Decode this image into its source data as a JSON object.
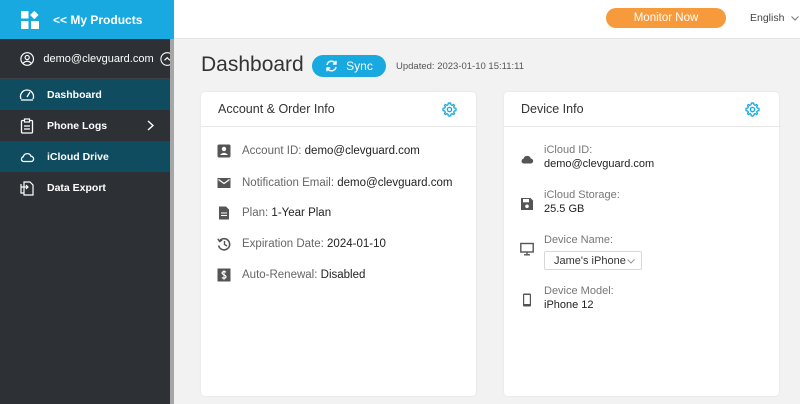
{
  "brand": {
    "title": "<< My Products"
  },
  "topbar": {
    "monitor_label": "Monitor Now",
    "language": "English"
  },
  "sidebar": {
    "user_email": "demo@clevguard.com",
    "items": [
      {
        "label": "Dashboard",
        "icon": "dashboard-gauge-icon",
        "active": true
      },
      {
        "label": "Phone Logs",
        "icon": "clipboard-icon",
        "active": false
      },
      {
        "label": "iCloud Drive",
        "icon": "cloud-icon",
        "active": true
      },
      {
        "label": "Data Export",
        "icon": "export-icon",
        "active": false
      }
    ]
  },
  "main": {
    "title": "Dashboard",
    "sync_label": "Sync",
    "updated": "Updated: 2023-01-10 15:11:11"
  },
  "account_card": {
    "title": "Account & Order Info",
    "rows": [
      {
        "label": "Account ID:",
        "value": "demo@clevguard.com",
        "icon": "id-card-icon"
      },
      {
        "label": "Notification Email:",
        "value": "demo@clevguard.com",
        "icon": "mail-icon"
      },
      {
        "label": "Plan:",
        "value": "1-Year Plan",
        "icon": "document-icon"
      },
      {
        "label": "Expiration Date:",
        "value": "2024-01-10",
        "icon": "history-icon"
      },
      {
        "label": "Auto-Renewal:",
        "value": "Disabled",
        "icon": "renewal-dollar-icon"
      }
    ]
  },
  "device_card": {
    "title": "Device Info",
    "rows": [
      {
        "label": "iCloud ID:",
        "value": "demo@clevguard.com",
        "icon": "cloud-icon"
      },
      {
        "label": "iCloud Storage:",
        "value": "25.5 GB",
        "icon": "save-icon"
      },
      {
        "label": "Device Name:",
        "value": "Jame's iPhone",
        "icon": "monitor-icon"
      },
      {
        "label": "Device Model:",
        "value": "iPhone 12",
        "icon": "smartphone-icon"
      }
    ]
  },
  "colors": {
    "accent": "#17a9df",
    "orange": "#f79a3b",
    "sidebar": "#2d3035",
    "active": "#0f4c60"
  }
}
